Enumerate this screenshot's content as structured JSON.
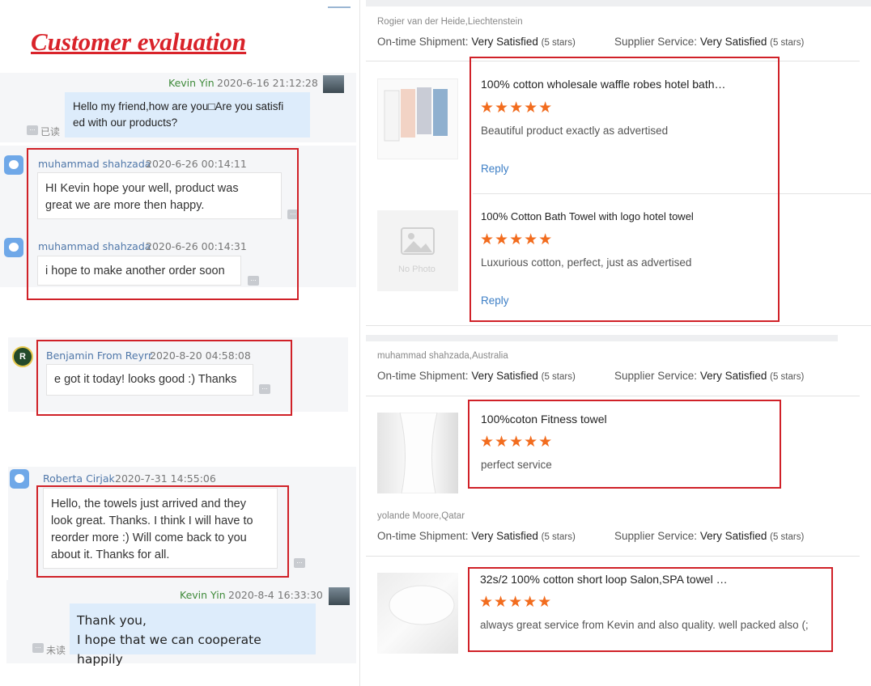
{
  "heading": "Customer evaluation",
  "chat": {
    "m1": {
      "name": "Kevin Yin",
      "time": "2020-6-16 21:12:28",
      "text1": "Hello my friend,how are you□Are you satisfi",
      "text2": "ed with our products?",
      "status": "已读"
    },
    "m2": {
      "name": "muhammad shahzada",
      "time": "2020-6-26 00:14:11",
      "text1": "HI Kevin hope your well, product was",
      "text2": "great we are more then happy."
    },
    "m3": {
      "name": "muhammad shahzada",
      "time": "2020-6-26 00:14:31",
      "text": "i hope to make another order soon"
    },
    "m4": {
      "name": "Benjamin From Reyrr",
      "time": "2020-8-20 04:58:08",
      "text": "e got it today! looks good :) Thanks"
    },
    "m5": {
      "name": "Roberta Cirjak",
      "time": "2020-7-31 14:55:06",
      "l1": "Hello, the towels just arrived and they",
      "l2": "look great. Thanks. I think I will have to",
      "l3": "reorder more :) Will come back to you",
      "l4": "about it. Thanks for all."
    },
    "m6": {
      "name": "Kevin Yin",
      "time": "2020-8-4 16:33:30",
      "l1": "Thank you,",
      "l2": "I hope that we can cooperate happily",
      "status": "未读"
    }
  },
  "labels": {
    "ontime": "On-time Shipment:",
    "supplier": "Supplier Service:",
    "very": "Very Satisfied",
    "five": "(5 stars)",
    "reply": "Reply",
    "stars": "★★★★★",
    "nophoto": "No Photo",
    "badge": "R"
  },
  "reviews": [
    {
      "reviewer": "Rogier van der Heide,Liechtenstein"
    },
    {
      "reviewer": "muhammad shahzada,Australia"
    },
    {
      "reviewer": "yolande Moore,Qatar"
    }
  ],
  "products": [
    {
      "title": "100% cotton wholesale waffle robes hotel bath…",
      "text": "Beautiful product exactly as advertised",
      "rating": 5
    },
    {
      "title": "100% Cotton Bath Towel with logo hotel towel",
      "text": "Luxurious cotton, perfect, just as advertised",
      "rating": 5
    },
    {
      "title": "100%coton Fitness towel",
      "text": "perfect service",
      "rating": 5
    },
    {
      "title": "32s/2 100% cotton short loop Salon,SPA towel …",
      "text": "always great service from Kevin and also quality.  well packed also (;",
      "rating": 5
    }
  ],
  "colors": {
    "accent_red": "#d9232a",
    "star": "#f26c1e",
    "link": "#3d7fc6",
    "bubble": "#ddecfb"
  }
}
